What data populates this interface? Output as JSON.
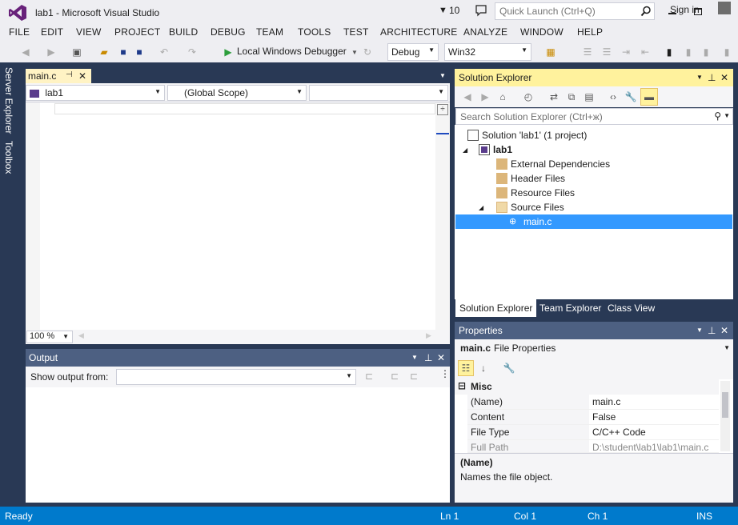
{
  "window": {
    "title": "lab1 - Microsoft Visual Studio",
    "notifications": "10",
    "quick_launch_placeholder": "Quick Launch (Ctrl+Q)"
  },
  "menu": [
    "FILE",
    "EDIT",
    "VIEW",
    "PROJECT",
    "BUILD",
    "DEBUG",
    "TEAM",
    "TOOLS",
    "TEST",
    "ARCHITECTURE",
    "ANALYZE",
    "WINDOW",
    "HELP"
  ],
  "signin": "Sign in",
  "toolbar": {
    "debugger": "Local Windows Debugger",
    "config": "Debug",
    "platform": "Win32"
  },
  "sidetabs": [
    "Server Explorer",
    "Toolbox"
  ],
  "editor": {
    "tab": "main.c",
    "nav_project": "lab1",
    "nav_scope": "(Global Scope)",
    "nav_member": "",
    "zoom": "100 %"
  },
  "output": {
    "title": "Output",
    "show_from_label": "Show output from:",
    "show_from_value": ""
  },
  "solution_explorer": {
    "title": "Solution Explorer",
    "search_placeholder": "Search Solution Explorer (Ctrl+ж)",
    "tree": [
      {
        "label": "Solution 'lab1' (1 project)",
        "icon": "solution-icon",
        "expander": ""
      },
      {
        "label": "lab1",
        "icon": "project-icon",
        "expander": "◢",
        "bold": true
      },
      {
        "label": "External Dependencies",
        "icon": "folder-icon",
        "expander": ""
      },
      {
        "label": "Header Files",
        "icon": "folder-icon",
        "expander": ""
      },
      {
        "label": "Resource Files",
        "icon": "folder-icon",
        "expander": ""
      },
      {
        "label": "Source Files",
        "icon": "folder-open-icon",
        "expander": "◢"
      },
      {
        "label": "main.c",
        "icon": "cpp-file-icon",
        "expander": "",
        "selected": true
      }
    ],
    "tabs": [
      "Solution Explorer",
      "Team Explorer",
      "Class View"
    ]
  },
  "properties": {
    "title": "Properties",
    "object_name": "main.c",
    "object_type": "File Properties",
    "category": "Misc",
    "rows": [
      {
        "name": "(Name)",
        "value": "main.c"
      },
      {
        "name": "Content",
        "value": "False"
      },
      {
        "name": "File Type",
        "value": "C/C++ Code"
      },
      {
        "name": "Full Path",
        "value": "D:\\student\\lab1\\lab1\\main.c"
      }
    ],
    "desc_title": "(Name)",
    "desc_text": "Names the file object."
  },
  "status": {
    "ready": "Ready",
    "ln": "Ln 1",
    "col": "Col 1",
    "ch": "Ch 1",
    "ins": "INS"
  },
  "colors": {
    "accent": "#007acc",
    "selection": "#3399ff",
    "active_title": "#fff29d",
    "frame": "#293955"
  }
}
